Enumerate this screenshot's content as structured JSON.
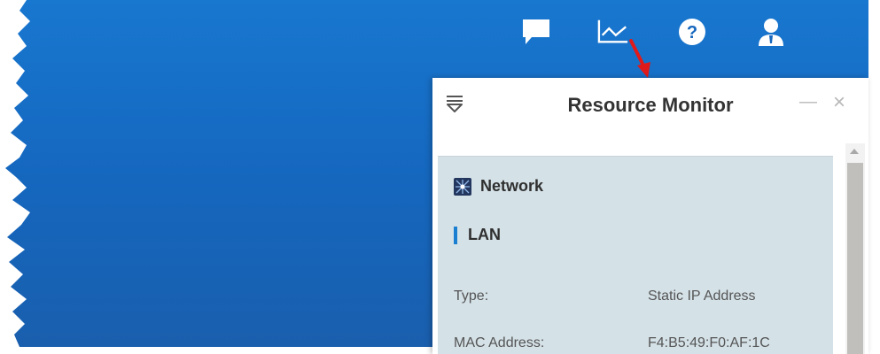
{
  "panel": {
    "title": "Resource Monitor"
  },
  "icons": {
    "chat": "chat-icon",
    "monitor": "line-chart-icon",
    "help": "help-icon",
    "account": "user-icon"
  },
  "network": {
    "title": "Network",
    "subsection": "LAN",
    "rows": [
      {
        "label": "Type:",
        "value": "Static IP Address"
      },
      {
        "label": "MAC Address:",
        "value": "F4:B5:49:F0:AF:1C"
      }
    ]
  },
  "colors": {
    "desktop": "#1566bd",
    "content_bg": "#d4e1e7",
    "accent": "#1a7fd1",
    "annotation_arrow": "#e01a1a"
  }
}
